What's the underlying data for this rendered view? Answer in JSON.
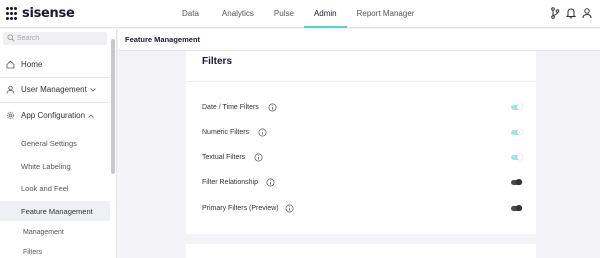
{
  "brand": {
    "name": "sisense"
  },
  "nav": {
    "items": [
      {
        "label": "Data"
      },
      {
        "label": "Analytics"
      },
      {
        "label": "Pulse"
      },
      {
        "label": "Admin",
        "active": true
      },
      {
        "label": "Report Manager"
      }
    ]
  },
  "top_icons": [
    "git-branch-icon",
    "bell-icon",
    "user-icon"
  ],
  "sidebar": {
    "search_placeholder": "Search",
    "items": {
      "home": "Home",
      "user_management": "User Management",
      "app_configuration": "App Configuration"
    },
    "sub_items": {
      "general_settings": "General Settings",
      "white_labeling": "White Labeling",
      "look_and_feel": "Look and Feel",
      "feature_management": "Feature Management"
    },
    "subsub_items": {
      "management": "Management",
      "filters": "Filters"
    }
  },
  "main": {
    "header_title": "Feature Management",
    "card_title": "Filters",
    "rows": [
      {
        "label": "Date / Time Filters",
        "enabled": true
      },
      {
        "label": "Numeric Filters",
        "enabled": true
      },
      {
        "label": "Textual Filters",
        "enabled": true
      },
      {
        "label": "Filter Relationship",
        "enabled": false
      },
      {
        "label": "Primary Filters (Preview)",
        "enabled": false
      }
    ]
  },
  "colors": {
    "accent": "#4ed7cf",
    "toggle_on": "#a6e6e1",
    "toggle_off": "#4a4a52"
  }
}
